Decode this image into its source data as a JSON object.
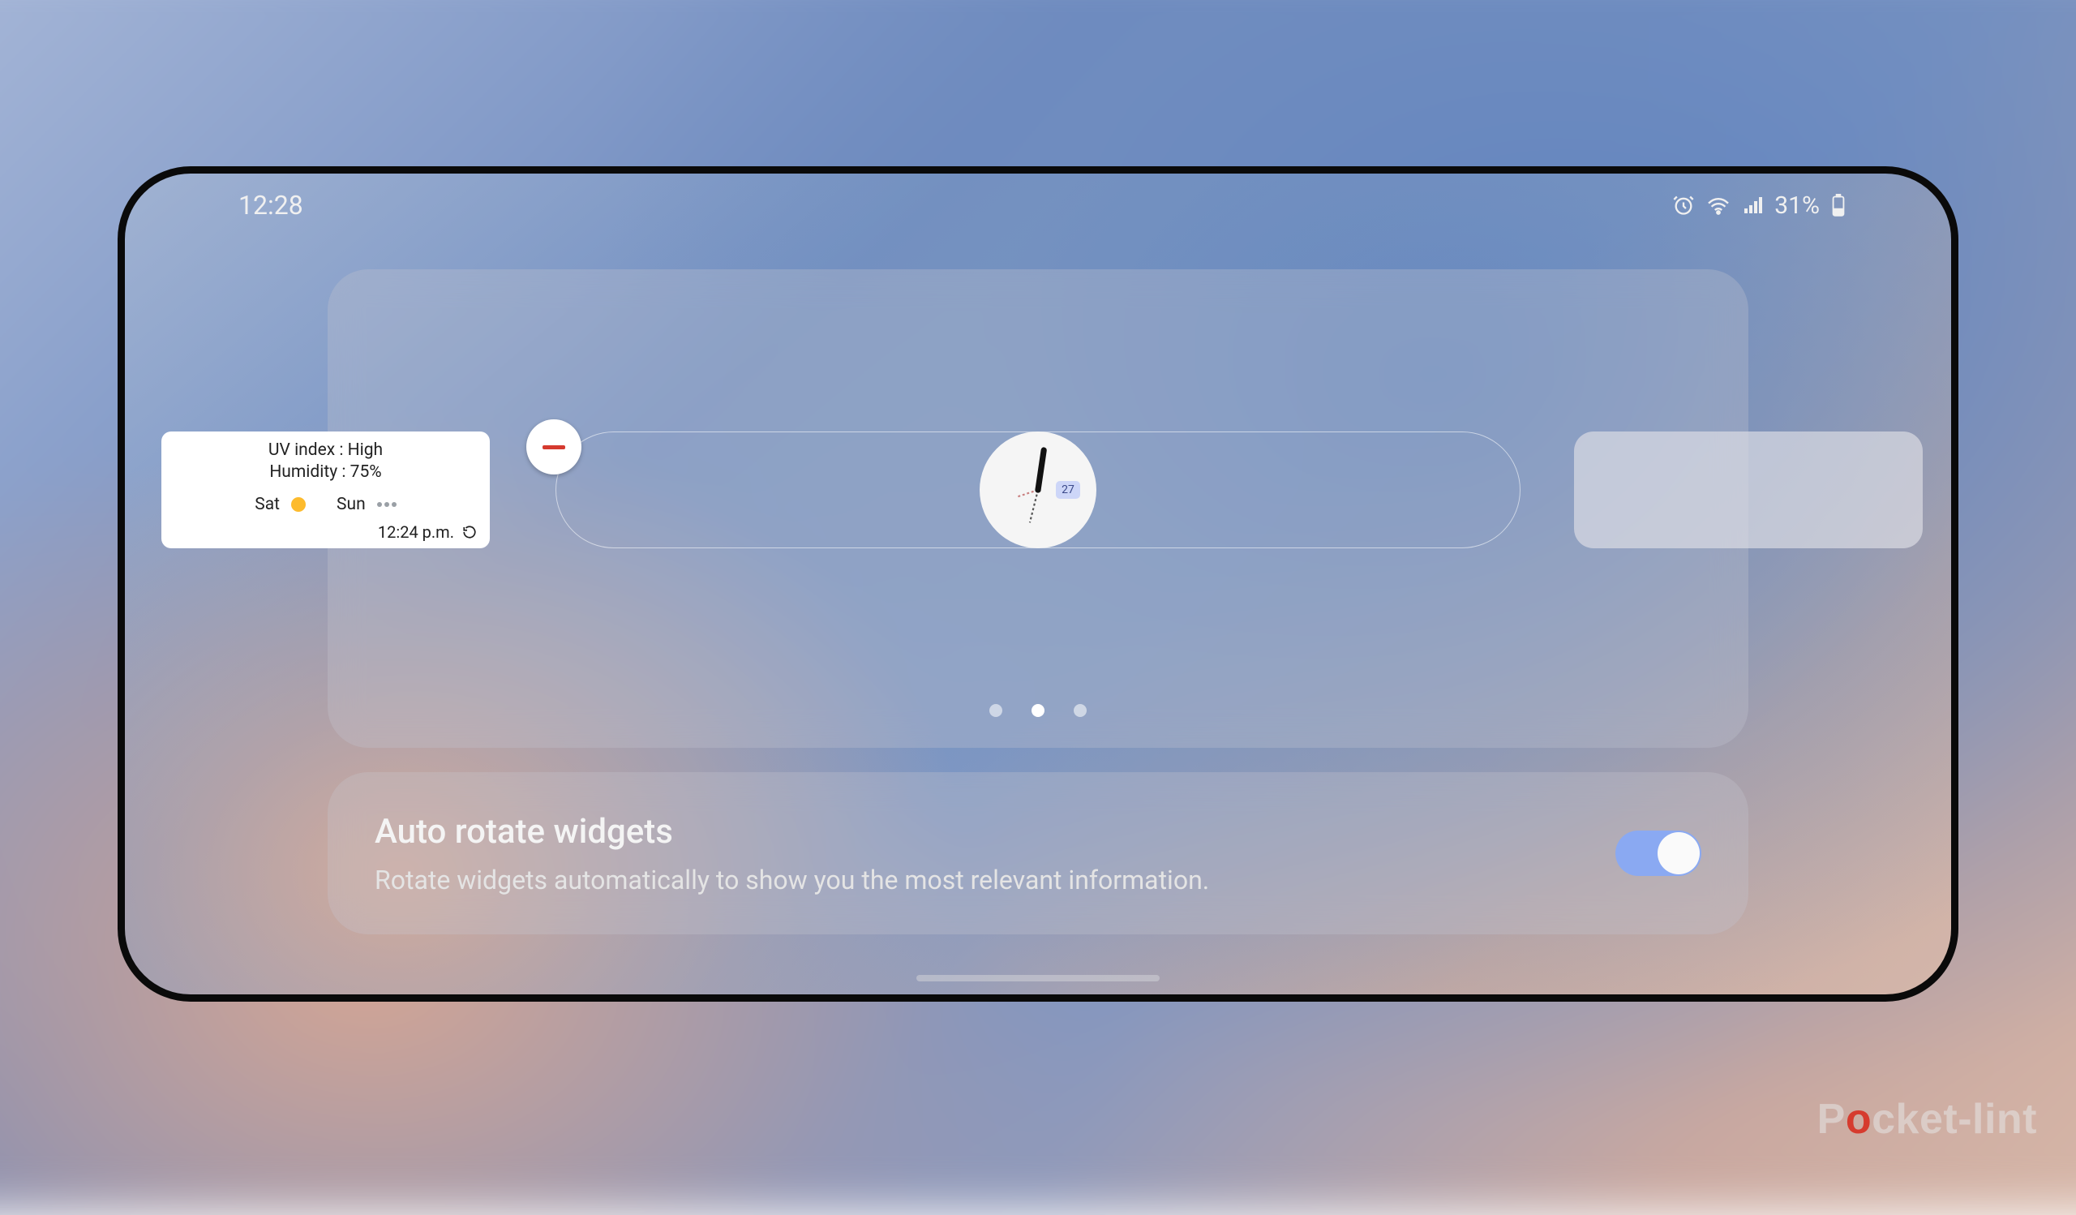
{
  "status": {
    "time": "12:28",
    "battery_percent": "31%"
  },
  "carousel": {
    "page_count": 3,
    "active_index": 1,
    "center_widget": {
      "type": "clock",
      "date_badge": "27"
    },
    "prev_widget": {
      "type": "weather",
      "uv_line": "UV index : High",
      "humidity_line": "Humidity : 75%",
      "days": [
        "Sat",
        "Sun"
      ],
      "updated": "12:24 p.m."
    }
  },
  "auto_rotate": {
    "title": "Auto rotate widgets",
    "description": "Rotate widgets automatically to show you the most relevant information.",
    "enabled": true
  },
  "watermark": {
    "prefix": "P",
    "accent": "o",
    "suffix": "cket-lint"
  }
}
